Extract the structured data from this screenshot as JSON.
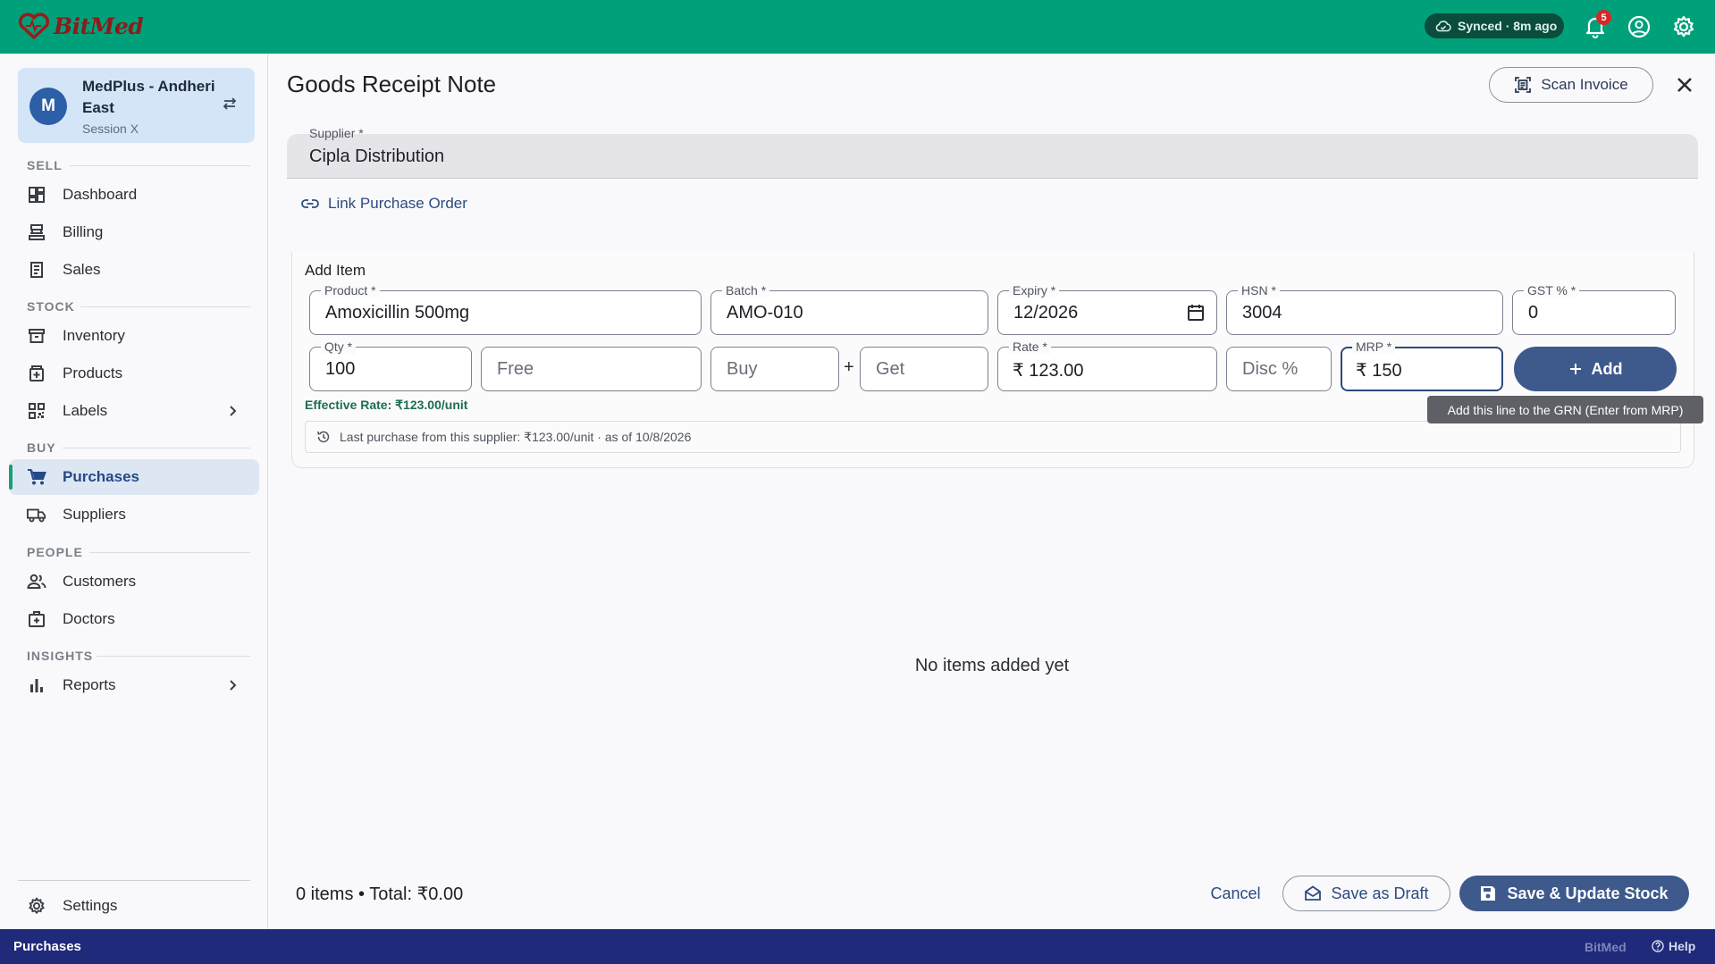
{
  "app": {
    "brand": "BitMed"
  },
  "topbar": {
    "sync_status": "Synced · 8m ago",
    "notification_count": "5"
  },
  "sidebar": {
    "store": {
      "avatar_initial": "M",
      "name": "MedPlus - Andheri East",
      "session": "Session X"
    },
    "sections": {
      "sell": "SELL",
      "stock": "STOCK",
      "buy": "BUY",
      "people": "PEOPLE",
      "insights": "INSIGHTS"
    },
    "items": {
      "dashboard": "Dashboard",
      "billing": "Billing",
      "sales": "Sales",
      "inventory": "Inventory",
      "products": "Products",
      "labels": "Labels",
      "purchases": "Purchases",
      "suppliers": "Suppliers",
      "customers": "Customers",
      "doctors": "Doctors",
      "reports": "Reports",
      "settings": "Settings"
    },
    "active_item": "purchases"
  },
  "page": {
    "title": "Goods Receipt Note",
    "scan_invoice_label": "Scan Invoice",
    "supplier": {
      "label": "Supplier *",
      "value": "Cipla Distribution"
    },
    "link_po_label": "Link Purchase Order"
  },
  "add_item": {
    "title": "Add Item",
    "product": {
      "label": "Product *",
      "value": "Amoxicillin 500mg"
    },
    "batch": {
      "label": "Batch *",
      "value": "AMO-010"
    },
    "expiry": {
      "label": "Expiry *",
      "value": "12/2026"
    },
    "hsn": {
      "label": "HSN *",
      "value": "3004"
    },
    "gst": {
      "label": "GST % *",
      "value": "0"
    },
    "qty": {
      "label": "Qty *",
      "value": "100"
    },
    "free": {
      "placeholder": "Free"
    },
    "buy": {
      "placeholder": "Buy"
    },
    "plus": "+",
    "get": {
      "placeholder": "Get"
    },
    "rate": {
      "label": "Rate *",
      "value": "₹ 123.00"
    },
    "disc": {
      "placeholder": "Disc %"
    },
    "mrp": {
      "label": "MRP *",
      "value": "₹ 150"
    },
    "add_label": "Add",
    "add_tooltip": "Add this line to the GRN (Enter from MRP)",
    "effective_rate": "Effective Rate: ₹123.00/unit",
    "last_purchase": "Last purchase from this supplier: ₹123.00/unit · as of 10/8/2026"
  },
  "items_list": {
    "empty_message": "No items added yet"
  },
  "footer": {
    "totals": "0 items • Total: ₹0.00",
    "cancel_label": "Cancel",
    "draft_label": "Save as Draft",
    "save_label": "Save & Update Stock"
  },
  "statusbar": {
    "current_page": "Purchases",
    "brand": "BitMed",
    "help_label": "Help"
  },
  "colors": {
    "topbar": "#00a07a",
    "primary": "#3e5a8c",
    "statusbar": "#1f2a7a",
    "active_accent": "#1b9f79",
    "effective_rate": "#1e6d52"
  }
}
